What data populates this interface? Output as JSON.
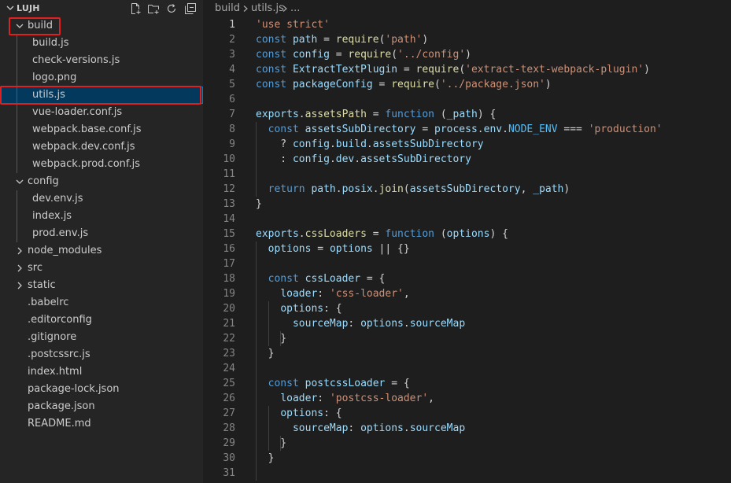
{
  "explorer": {
    "title": "LUJH",
    "actions": [
      "new-file-icon",
      "new-folder-icon",
      "refresh-icon",
      "collapse-all-icon"
    ],
    "tree": [
      {
        "label": "build",
        "depth": 0,
        "type": "folder",
        "expanded": true,
        "highlighted": true
      },
      {
        "label": "build.js",
        "depth": 1,
        "type": "file"
      },
      {
        "label": "check-versions.js",
        "depth": 1,
        "type": "file"
      },
      {
        "label": "logo.png",
        "depth": 1,
        "type": "file"
      },
      {
        "label": "utils.js",
        "depth": 1,
        "type": "file",
        "selected": true,
        "highlighted": true
      },
      {
        "label": "vue-loader.conf.js",
        "depth": 1,
        "type": "file"
      },
      {
        "label": "webpack.base.conf.js",
        "depth": 1,
        "type": "file"
      },
      {
        "label": "webpack.dev.conf.js",
        "depth": 1,
        "type": "file"
      },
      {
        "label": "webpack.prod.conf.js",
        "depth": 1,
        "type": "file"
      },
      {
        "label": "config",
        "depth": 0,
        "type": "folder",
        "expanded": true
      },
      {
        "label": "dev.env.js",
        "depth": 1,
        "type": "file"
      },
      {
        "label": "index.js",
        "depth": 1,
        "type": "file"
      },
      {
        "label": "prod.env.js",
        "depth": 1,
        "type": "file"
      },
      {
        "label": "node_modules",
        "depth": 0,
        "type": "folder",
        "expanded": false
      },
      {
        "label": "src",
        "depth": 0,
        "type": "folder",
        "expanded": false
      },
      {
        "label": "static",
        "depth": 0,
        "type": "folder",
        "expanded": false
      },
      {
        "label": ".babelrc",
        "depth": 0,
        "type": "file"
      },
      {
        "label": ".editorconfig",
        "depth": 0,
        "type": "file"
      },
      {
        "label": ".gitignore",
        "depth": 0,
        "type": "file"
      },
      {
        "label": ".postcssrc.js",
        "depth": 0,
        "type": "file"
      },
      {
        "label": "index.html",
        "depth": 0,
        "type": "file"
      },
      {
        "label": "package-lock.json",
        "depth": 0,
        "type": "file"
      },
      {
        "label": "package.json",
        "depth": 0,
        "type": "file"
      },
      {
        "label": "README.md",
        "depth": 0,
        "type": "file"
      }
    ]
  },
  "breadcrumb": {
    "folder": "build",
    "file": "utils.js",
    "more": "..."
  },
  "editor": {
    "active_line": 1,
    "lines": [
      [
        [
          "'use strict'",
          "str"
        ]
      ],
      [
        [
          "const",
          "kw"
        ],
        [
          " ",
          "op"
        ],
        [
          "path",
          "var"
        ],
        [
          " = ",
          "op"
        ],
        [
          "require",
          "fn"
        ],
        [
          "(",
          "op"
        ],
        [
          "'path'",
          "str"
        ],
        [
          ")",
          "op"
        ]
      ],
      [
        [
          "const",
          "kw"
        ],
        [
          " ",
          "op"
        ],
        [
          "config",
          "var"
        ],
        [
          " = ",
          "op"
        ],
        [
          "require",
          "fn"
        ],
        [
          "(",
          "op"
        ],
        [
          "'../config'",
          "str"
        ],
        [
          ")",
          "op"
        ]
      ],
      [
        [
          "const",
          "kw"
        ],
        [
          " ",
          "op"
        ],
        [
          "ExtractTextPlugin",
          "var"
        ],
        [
          " = ",
          "op"
        ],
        [
          "require",
          "fn"
        ],
        [
          "(",
          "op"
        ],
        [
          "'extract-text-webpack-plugin'",
          "str"
        ],
        [
          ")",
          "op"
        ]
      ],
      [
        [
          "const",
          "kw"
        ],
        [
          " ",
          "op"
        ],
        [
          "packageConfig",
          "var"
        ],
        [
          " = ",
          "op"
        ],
        [
          "require",
          "fn"
        ],
        [
          "(",
          "op"
        ],
        [
          "'../package.json'",
          "str"
        ],
        [
          ")",
          "op"
        ]
      ],
      [],
      [
        [
          "exports",
          "var"
        ],
        [
          ".",
          "op"
        ],
        [
          "assetsPath",
          "fn"
        ],
        [
          " = ",
          "op"
        ],
        [
          "function",
          "kw"
        ],
        [
          " (",
          "op"
        ],
        [
          "_path",
          "var"
        ],
        [
          ") {",
          "op"
        ]
      ],
      [
        [
          "  ",
          "op"
        ],
        [
          "const",
          "kw"
        ],
        [
          " ",
          "op"
        ],
        [
          "assetsSubDirectory",
          "var"
        ],
        [
          " = ",
          "op"
        ],
        [
          "process",
          "var"
        ],
        [
          ".",
          "op"
        ],
        [
          "env",
          "var"
        ],
        [
          ".",
          "op"
        ],
        [
          "NODE_ENV",
          "const"
        ],
        [
          " === ",
          "op"
        ],
        [
          "'production'",
          "str"
        ]
      ],
      [
        [
          "    ? ",
          "op"
        ],
        [
          "config",
          "var"
        ],
        [
          ".",
          "op"
        ],
        [
          "build",
          "var"
        ],
        [
          ".",
          "op"
        ],
        [
          "assetsSubDirectory",
          "var"
        ]
      ],
      [
        [
          "    : ",
          "op"
        ],
        [
          "config",
          "var"
        ],
        [
          ".",
          "op"
        ],
        [
          "dev",
          "var"
        ],
        [
          ".",
          "op"
        ],
        [
          "assetsSubDirectory",
          "var"
        ]
      ],
      [],
      [
        [
          "  ",
          "op"
        ],
        [
          "return",
          "kw"
        ],
        [
          " ",
          "op"
        ],
        [
          "path",
          "var"
        ],
        [
          ".",
          "op"
        ],
        [
          "posix",
          "var"
        ],
        [
          ".",
          "op"
        ],
        [
          "join",
          "fn"
        ],
        [
          "(",
          "op"
        ],
        [
          "assetsSubDirectory",
          "var"
        ],
        [
          ", ",
          "op"
        ],
        [
          "_path",
          "var"
        ],
        [
          ")",
          "op"
        ]
      ],
      [
        [
          "}",
          "op"
        ]
      ],
      [],
      [
        [
          "exports",
          "var"
        ],
        [
          ".",
          "op"
        ],
        [
          "cssLoaders",
          "fn"
        ],
        [
          " = ",
          "op"
        ],
        [
          "function",
          "kw"
        ],
        [
          " (",
          "op"
        ],
        [
          "options",
          "var"
        ],
        [
          ") {",
          "op"
        ]
      ],
      [
        [
          "  ",
          "op"
        ],
        [
          "options",
          "var"
        ],
        [
          " = ",
          "op"
        ],
        [
          "options",
          "var"
        ],
        [
          " || {}",
          "op"
        ]
      ],
      [],
      [
        [
          "  ",
          "op"
        ],
        [
          "const",
          "kw"
        ],
        [
          " ",
          "op"
        ],
        [
          "cssLoader",
          "var"
        ],
        [
          " = {",
          "op"
        ]
      ],
      [
        [
          "    ",
          "op"
        ],
        [
          "loader",
          "var"
        ],
        [
          ": ",
          "op"
        ],
        [
          "'css-loader'",
          "str"
        ],
        [
          ",",
          "op"
        ]
      ],
      [
        [
          "    ",
          "op"
        ],
        [
          "options",
          "var"
        ],
        [
          ": {",
          "op"
        ]
      ],
      [
        [
          "      ",
          "op"
        ],
        [
          "sourceMap",
          "var"
        ],
        [
          ": ",
          "op"
        ],
        [
          "options",
          "var"
        ],
        [
          ".",
          "op"
        ],
        [
          "sourceMap",
          "var"
        ]
      ],
      [
        [
          "    }",
          "op"
        ]
      ],
      [
        [
          "  }",
          "op"
        ]
      ],
      [],
      [
        [
          "  ",
          "op"
        ],
        [
          "const",
          "kw"
        ],
        [
          " ",
          "op"
        ],
        [
          "postcssLoader",
          "var"
        ],
        [
          " = {",
          "op"
        ]
      ],
      [
        [
          "    ",
          "op"
        ],
        [
          "loader",
          "var"
        ],
        [
          ": ",
          "op"
        ],
        [
          "'postcss-loader'",
          "str"
        ],
        [
          ",",
          "op"
        ]
      ],
      [
        [
          "    ",
          "op"
        ],
        [
          "options",
          "var"
        ],
        [
          ": {",
          "op"
        ]
      ],
      [
        [
          "      ",
          "op"
        ],
        [
          "sourceMap",
          "var"
        ],
        [
          ": ",
          "op"
        ],
        [
          "options",
          "var"
        ],
        [
          ".",
          "op"
        ],
        [
          "sourceMap",
          "var"
        ]
      ],
      [
        [
          "    }",
          "op"
        ]
      ],
      [
        [
          "  }",
          "op"
        ]
      ],
      []
    ]
  }
}
